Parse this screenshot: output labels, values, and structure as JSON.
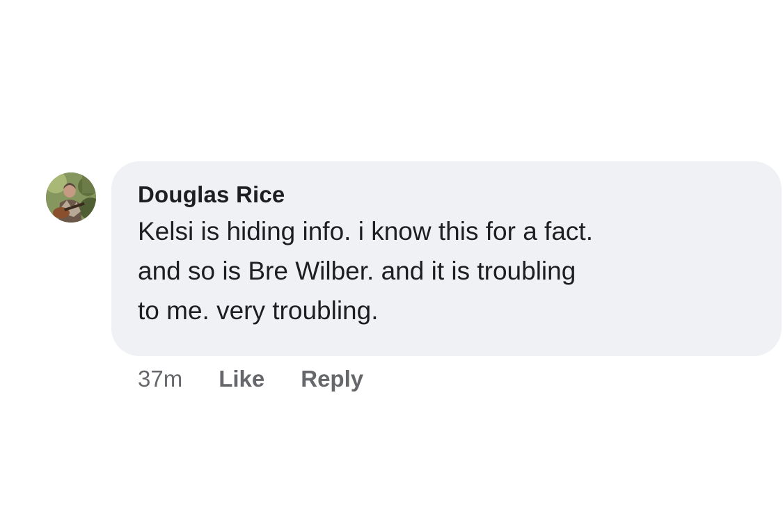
{
  "comment": {
    "author": "Douglas Rice",
    "text": "Kelsi is hiding info. i know this for a fact.\nand so is Bre Wilber. and it is troubling\nto me. very troubling.",
    "timestamp": "37m",
    "actions": {
      "like_label": "Like",
      "reply_label": "Reply"
    },
    "avatar_icon": "profile-photo-avatar"
  },
  "colors": {
    "bubble_background": "#f0f1f5",
    "text": "#1c1e21",
    "secondary_text": "#65676b"
  }
}
